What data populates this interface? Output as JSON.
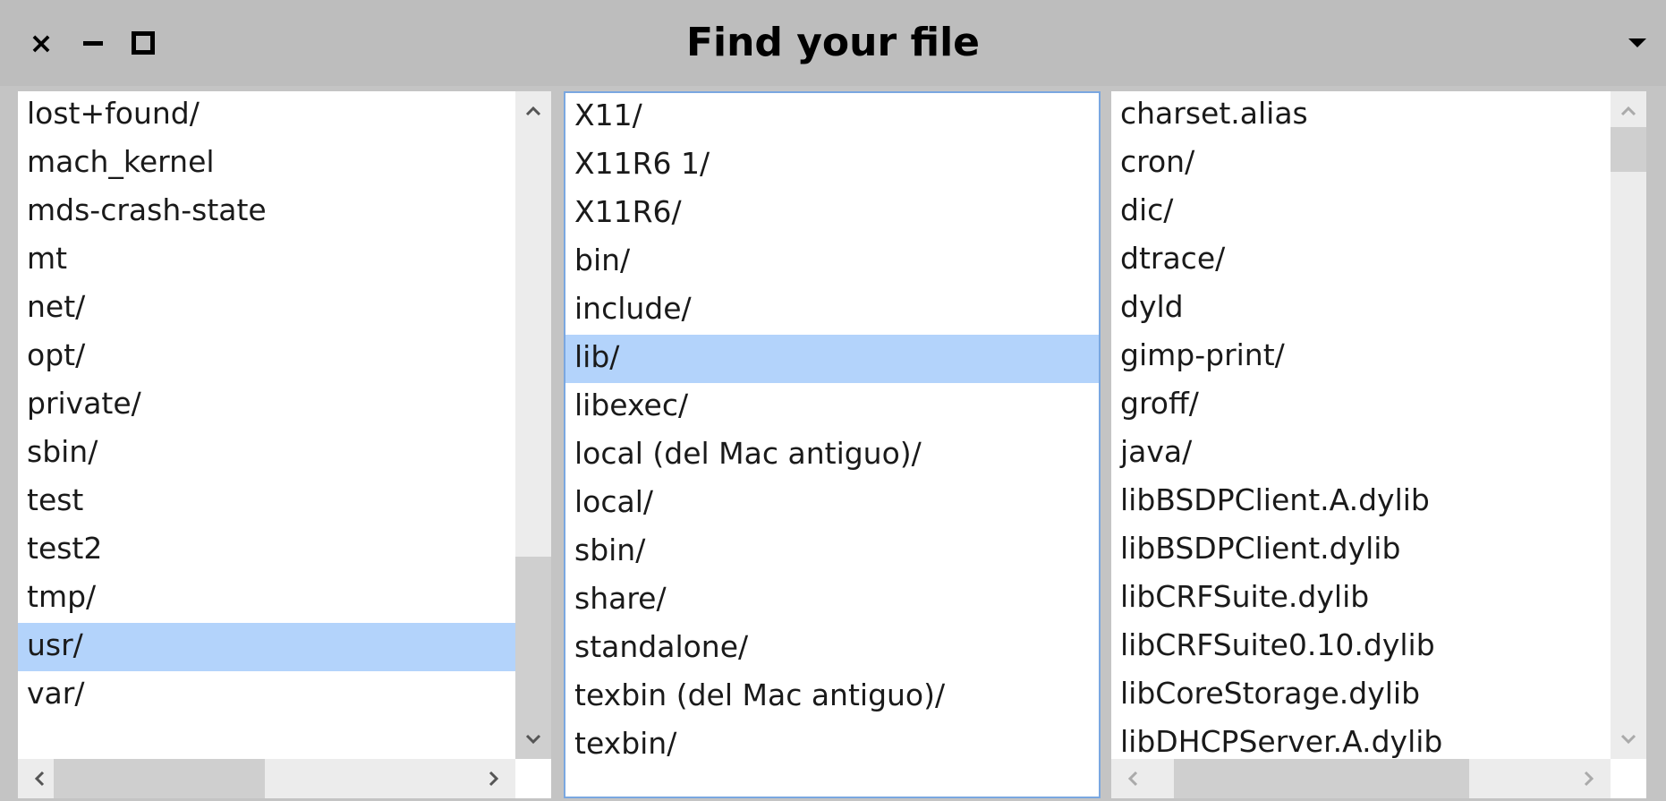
{
  "window": {
    "title": "Find your file"
  },
  "panes": [
    {
      "items": [
        "lost+found/",
        "mach_kernel",
        "mds-crash-state",
        "mt",
        "net/",
        "opt/",
        "private/",
        "sbin/",
        "test",
        "test2",
        "tmp/",
        "usr/",
        "var/"
      ],
      "selected": "usr/"
    },
    {
      "items": [
        "X11/",
        "X11R6 1/",
        "X11R6/",
        "bin/",
        "include/",
        "lib/",
        "libexec/",
        "local (del Mac antiguo)/",
        "local/",
        "sbin/",
        "share/",
        "standalone/",
        "texbin (del Mac antiguo)/",
        "texbin/"
      ],
      "selected": "lib/"
    },
    {
      "items": [
        "charset.alias",
        "cron/",
        "dic/",
        "dtrace/",
        "dyld",
        "gimp-print/",
        "groff/",
        "java/",
        "libBSDPClient.A.dylib",
        "libBSDPClient.dylib",
        "libCRFSuite.dylib",
        "libCRFSuite0.10.dylib",
        "libCoreStorage.dylib",
        "libDHCPServer.A.dylib"
      ],
      "selected": null
    }
  ],
  "icons": {
    "close": "close-icon",
    "minimize": "minimize-icon",
    "maximize": "maximize-icon",
    "menu": "dropdown-menu-icon"
  }
}
